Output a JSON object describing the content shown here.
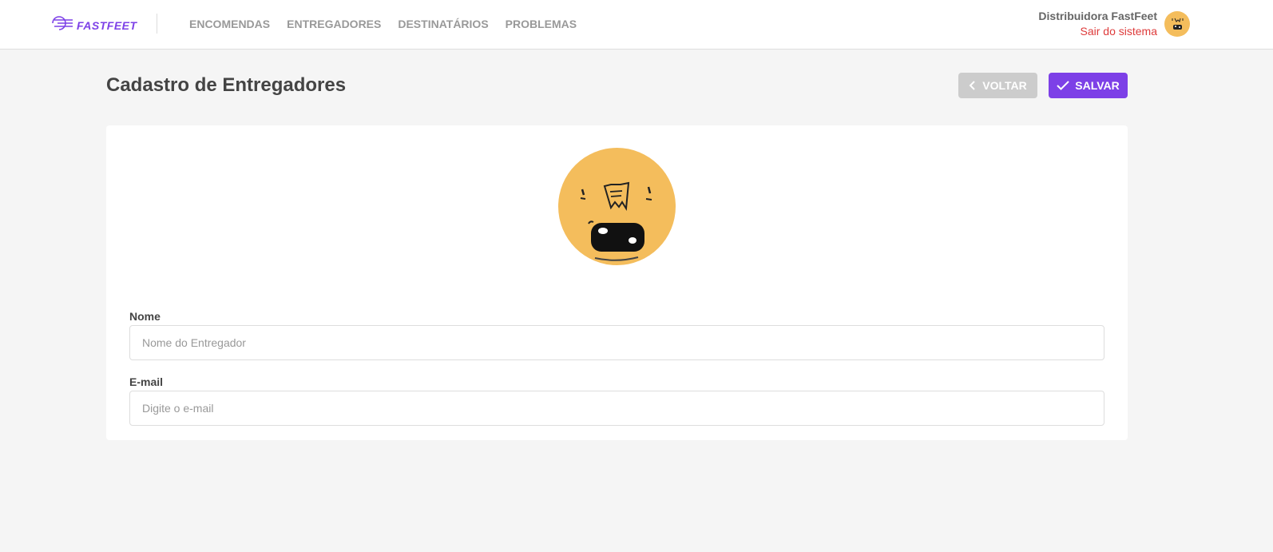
{
  "header": {
    "logo_text": "FASTFEET",
    "nav": [
      "ENCOMENDAS",
      "ENTREGADORES",
      "DESTINATÁRIOS",
      "PROBLEMAS"
    ],
    "profile": {
      "name": "Distribuidora FastFeet",
      "logout": "Sair do sistema"
    }
  },
  "page": {
    "title": "Cadastro de Entregadores",
    "back_label": "VOLTAR",
    "save_label": "SALVAR"
  },
  "form": {
    "name_label": "Nome",
    "name_placeholder": "Nome do Entregador",
    "name_value": "",
    "email_label": "E-mail",
    "email_placeholder": "Digite o e-mail",
    "email_value": ""
  },
  "colors": {
    "brand": "#7d40e7",
    "logout": "#de3b3b",
    "avatar": "#f4bd5c",
    "back_button": "#cccccc"
  },
  "icons": {
    "logo": "delivery-truck-icon",
    "back": "chevron-left-icon",
    "save": "check-icon",
    "avatar": "face-avatar-icon"
  }
}
